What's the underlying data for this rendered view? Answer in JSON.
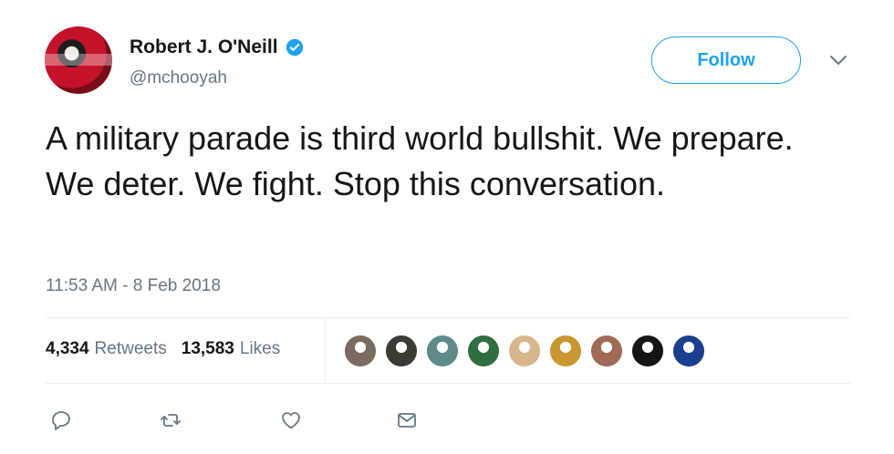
{
  "author": {
    "name": "Robert J. O'Neill",
    "handle": "@mchooyah",
    "verified": true,
    "avatar_icon": "user-avatar"
  },
  "follow_label": "Follow",
  "menu_icon": "chevron-down-icon",
  "tweet": {
    "text": "A military parade is third world bullshit. We prepare. We deter. We fight. Stop this conversation.",
    "timestamp": "11:53 AM - 8 Feb 2018"
  },
  "stats": {
    "retweets_count": "4,334",
    "retweets_label": "Retweets",
    "likes_count": "13,583",
    "likes_label": "Likes"
  },
  "likers": [
    {
      "name": "liker-avatar",
      "color": "#7a6a60"
    },
    {
      "name": "liker-avatar",
      "color": "#3b3b33"
    },
    {
      "name": "liker-avatar",
      "color": "#5e8a8c"
    },
    {
      "name": "liker-avatar",
      "color": "#2f6e3e"
    },
    {
      "name": "liker-avatar",
      "color": "#d8b58a"
    },
    {
      "name": "liker-avatar",
      "color": "#c9962f"
    },
    {
      "name": "liker-avatar",
      "color": "#a06a57"
    },
    {
      "name": "liker-avatar",
      "color": "#151515"
    },
    {
      "name": "liker-avatar",
      "color": "#1a3f8f"
    }
  ],
  "actions": [
    {
      "name": "reply-icon"
    },
    {
      "name": "retweet-icon"
    },
    {
      "name": "like-icon"
    },
    {
      "name": "message-icon"
    }
  ],
  "colors": {
    "accent": "#1da1f2",
    "text": "#14171a",
    "secondary": "#657786",
    "divider": "#e6ecf0"
  }
}
